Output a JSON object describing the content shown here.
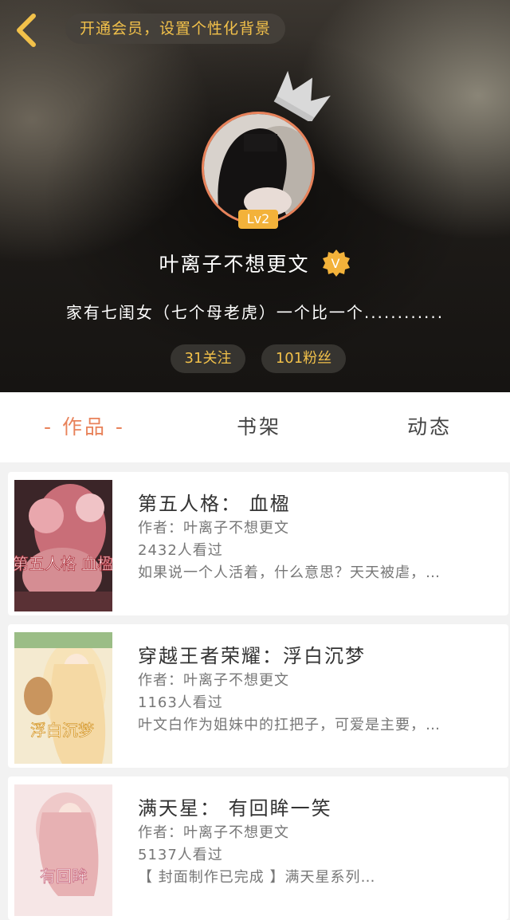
{
  "header": {
    "vip_prompt": "开通会员，设置个性化背景",
    "level": "Lv2",
    "username": "叶离子不想更文",
    "verified_mark": "V",
    "bio": "家有七闺女（七个母老虎）一个比一个............",
    "following": "31关注",
    "followers": "101粉丝"
  },
  "tabs": [
    {
      "label": "- 作品 -",
      "active": true
    },
    {
      "label": "书架",
      "active": false
    },
    {
      "label": "动态",
      "active": false
    }
  ],
  "works": [
    {
      "title": "第五人格： 血楹",
      "author": "作者：叶离子不想更文",
      "views": "2432人看过",
      "summary": "如果说一个人活着，什么意思？天天被虐，…",
      "cover_text": "第五人格 血楹"
    },
    {
      "title": "穿越王者荣耀：浮白沉梦",
      "author": "作者：叶离子不想更文",
      "views": "1163人看过",
      "summary": "叶文白作为姐妹中的扛把子，可爱是主要，…",
      "cover_text": "浮白沉梦"
    },
    {
      "title": "满天星： 有回眸一笑",
      "author": "作者：叶离子不想更文",
      "views": "5137人看过",
      "summary": "【 封面制作已完成 】满天星系列…",
      "cover_text": "有回眸"
    }
  ],
  "colors": {
    "accent": "#e8825a",
    "gold": "#f2c14a"
  }
}
